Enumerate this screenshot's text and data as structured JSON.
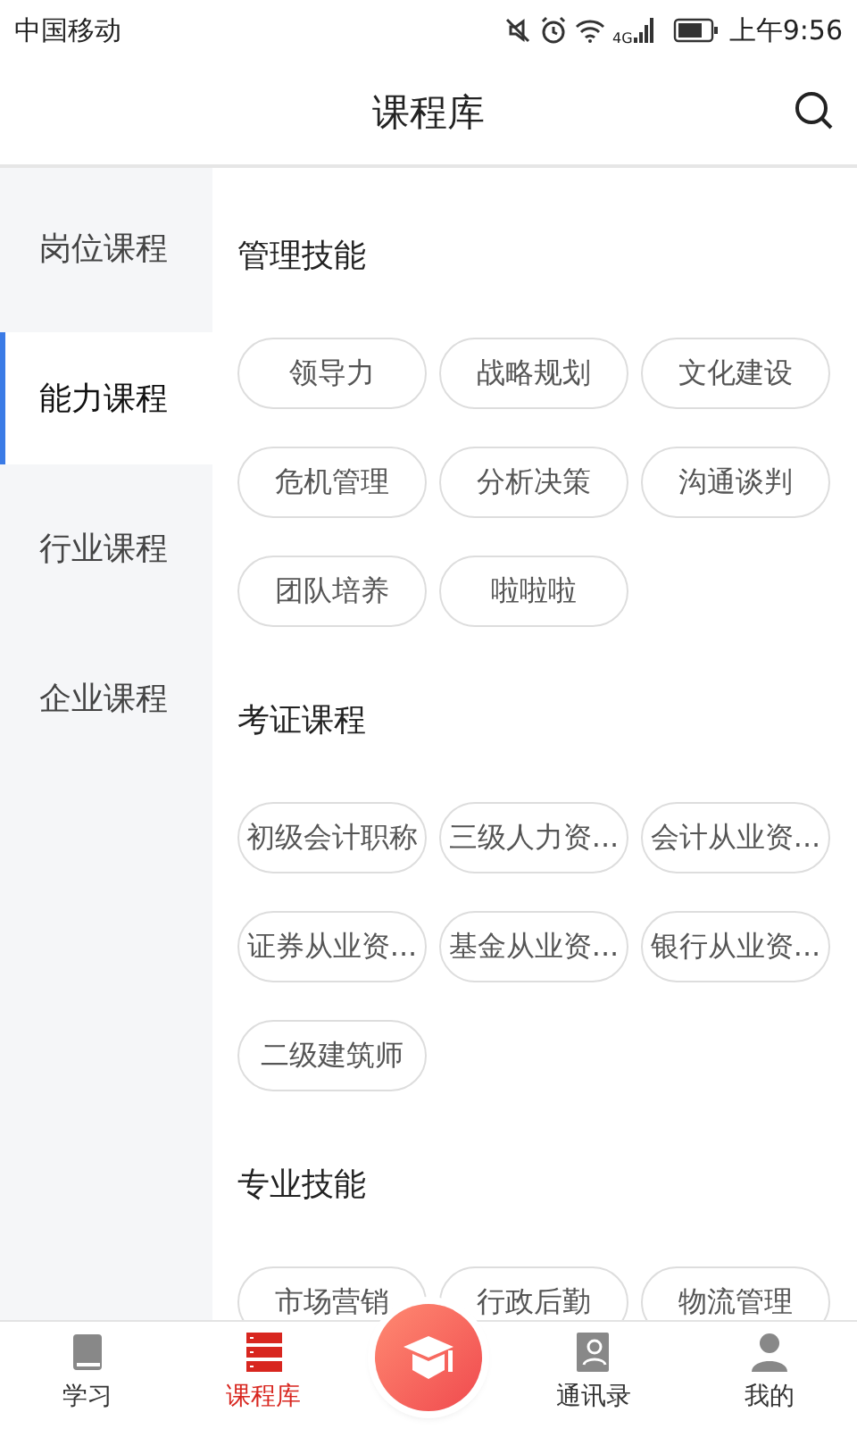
{
  "status_bar": {
    "carrier": "中国移动",
    "network": "4G",
    "time": "上午9:56"
  },
  "header": {
    "title": "课程库"
  },
  "sidebar": {
    "items": [
      {
        "label": "岗位课程",
        "selected": false
      },
      {
        "label": "能力课程",
        "selected": true
      },
      {
        "label": "行业课程",
        "selected": false
      },
      {
        "label": "企业课程",
        "selected": false
      }
    ]
  },
  "sections": [
    {
      "title": "管理技能",
      "tags": [
        "领导力",
        "战略规划",
        "文化建设",
        "危机管理",
        "分析决策",
        "沟通谈判",
        "团队培养",
        "啦啦啦"
      ]
    },
    {
      "title": "考证课程",
      "tags": [
        "初级会计职称",
        "三级人力资...",
        "会计从业资...",
        "证券从业资...",
        "基金从业资...",
        "银行从业资...",
        "二级建筑师"
      ]
    },
    {
      "title": "专业技能",
      "tags": [
        "市场营销",
        "行政后勤",
        "物流管理"
      ]
    }
  ],
  "tab_bar": {
    "items": [
      {
        "kind": "tab",
        "label": "学习",
        "selected": false
      },
      {
        "kind": "tab",
        "label": "课程库",
        "selected": true
      },
      {
        "kind": "center"
      },
      {
        "kind": "tab",
        "label": "通讯录",
        "selected": false
      },
      {
        "kind": "tab",
        "label": "我的",
        "selected": false
      }
    ]
  }
}
